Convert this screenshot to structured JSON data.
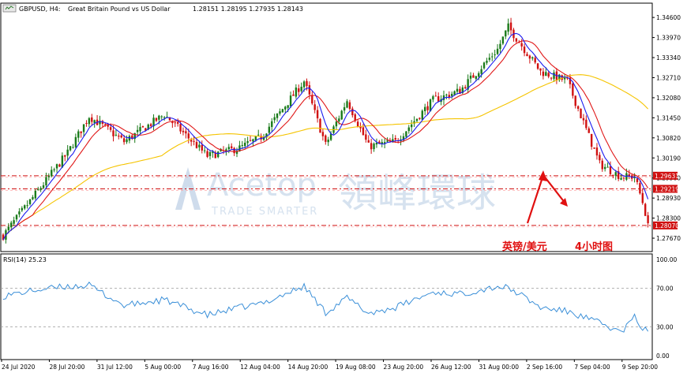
{
  "header": {
    "symbol": "GBPUSD, H4:",
    "description": "Great Britain Pound vs US Dollar",
    "ohlc": "1.28151 1.28195 1.27935 1.28143"
  },
  "watermark": {
    "brand": "Acetop",
    "cn": "領峰環球",
    "tagline": "TRADE SMARTER"
  },
  "annotation": {
    "pair_cn": "英镑/美元",
    "timeframe_cn": "4小时图"
  },
  "rsi_title": "RSI(14) 25.23",
  "colors": {
    "bull": "#1a7a1a",
    "bear": "#d01010",
    "ma_short": "#1c1cf0",
    "ma_mid": "#e01818",
    "ma_long": "#f5c400",
    "rsi": "#3a8fd8",
    "hline": "#d01010",
    "arrow": "#e01010"
  },
  "chart_data": [
    {
      "type": "candlestick",
      "title": "GBPUSD, H4",
      "ylim": [
        1.2725,
        1.3495
      ],
      "y_ticks": [
        "1.34600",
        "1.33970",
        "1.33340",
        "1.32710",
        "1.32080",
        "1.31450",
        "1.30820",
        "1.30190",
        "1.29560",
        "1.28930",
        "1.28300",
        "1.27670"
      ],
      "x_ticks": [
        "24 Jul 2020",
        "28 Jul 20:00",
        "31 Jul 12:00",
        "5 Aug 00:00",
        "7 Aug 16:00",
        "12 Aug 04:00",
        "14 Aug 20:00",
        "19 Aug 08:00",
        "23 Aug 20:00",
        "26 Aug 12:00",
        "31 Aug 00:00",
        "2 Sep 16:00",
        "7 Sep 04:00",
        "9 Sep 20:00"
      ],
      "price_labels": [
        {
          "label": "1.29631",
          "value": 1.29631
        },
        {
          "label": "1.29219",
          "value": 1.29219
        },
        {
          "label": "1.28070",
          "value": 1.2807
        }
      ],
      "key_points": [
        {
          "x": 0,
          "value": 1.2775
        },
        {
          "x": 12,
          "value": 1.2905
        },
        {
          "x": 24,
          "value": 1.3035
        },
        {
          "x": 32,
          "value": 1.315
        },
        {
          "x": 45,
          "value": 1.307
        },
        {
          "x": 60,
          "value": 1.3155
        },
        {
          "x": 76,
          "value": 1.3025
        },
        {
          "x": 88,
          "value": 1.305
        },
        {
          "x": 96,
          "value": 1.3085
        },
        {
          "x": 112,
          "value": 1.326
        },
        {
          "x": 120,
          "value": 1.306
        },
        {
          "x": 128,
          "value": 1.32
        },
        {
          "x": 136,
          "value": 1.3055
        },
        {
          "x": 146,
          "value": 1.307
        },
        {
          "x": 160,
          "value": 1.32
        },
        {
          "x": 170,
          "value": 1.323
        },
        {
          "x": 184,
          "value": 1.336
        },
        {
          "x": 188,
          "value": 1.343
        },
        {
          "x": 191,
          "value": 1.3395
        },
        {
          "x": 200,
          "value": 1.329
        },
        {
          "x": 210,
          "value": 1.326
        },
        {
          "x": 222,
          "value": 1.3
        },
        {
          "x": 230,
          "value": 1.296
        },
        {
          "x": 235,
          "value": 1.296
        },
        {
          "x": 238,
          "value": 1.288
        },
        {
          "x": 240,
          "value": 1.2814
        }
      ]
    },
    {
      "type": "line",
      "title": "RSI(14) 25.23",
      "ylim": [
        0,
        100
      ],
      "y_ticks": [
        "100.00",
        "70.00",
        "30.00",
        "0.00"
      ],
      "levels": [
        70,
        30
      ],
      "last_value": 25.23,
      "key_points": [
        {
          "x": 0,
          "value": 62
        },
        {
          "x": 12,
          "value": 68
        },
        {
          "x": 24,
          "value": 72
        },
        {
          "x": 32,
          "value": 73
        },
        {
          "x": 45,
          "value": 52
        },
        {
          "x": 60,
          "value": 58
        },
        {
          "x": 76,
          "value": 42
        },
        {
          "x": 88,
          "value": 50
        },
        {
          "x": 96,
          "value": 54
        },
        {
          "x": 112,
          "value": 72
        },
        {
          "x": 120,
          "value": 45
        },
        {
          "x": 128,
          "value": 60
        },
        {
          "x": 136,
          "value": 44
        },
        {
          "x": 146,
          "value": 50
        },
        {
          "x": 160,
          "value": 66
        },
        {
          "x": 170,
          "value": 64
        },
        {
          "x": 184,
          "value": 72
        },
        {
          "x": 188,
          "value": 70
        },
        {
          "x": 191,
          "value": 66
        },
        {
          "x": 200,
          "value": 50
        },
        {
          "x": 210,
          "value": 46
        },
        {
          "x": 222,
          "value": 34
        },
        {
          "x": 230,
          "value": 24
        },
        {
          "x": 235,
          "value": 40
        },
        {
          "x": 238,
          "value": 28
        },
        {
          "x": 240,
          "value": 25.23
        }
      ]
    }
  ]
}
